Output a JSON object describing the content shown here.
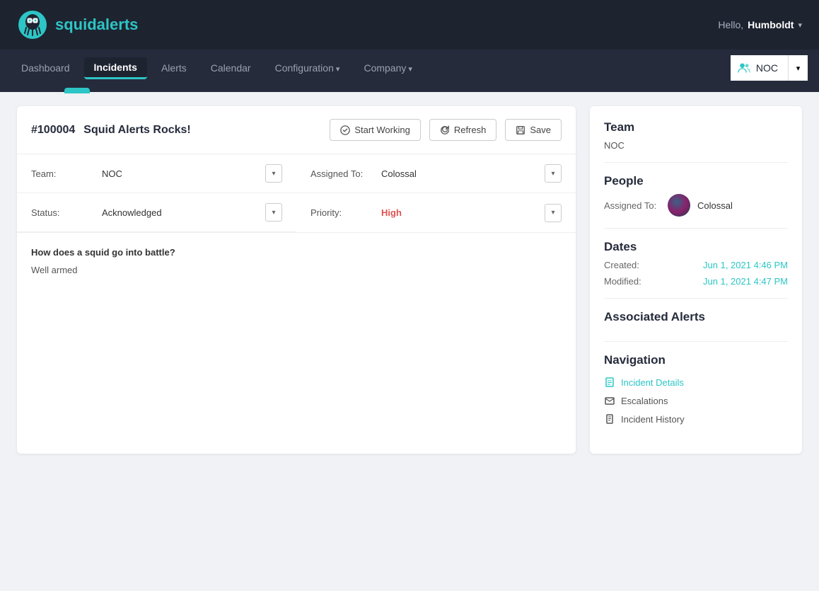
{
  "app": {
    "name_prefix": "squid",
    "name_suffix": "alerts"
  },
  "user": {
    "greeting": "Hello,",
    "username": "Humboldt"
  },
  "nav": {
    "items": [
      {
        "label": "Dashboard",
        "active": false,
        "has_arrow": false
      },
      {
        "label": "Incidents",
        "active": true,
        "has_arrow": false
      },
      {
        "label": "Alerts",
        "active": false,
        "has_arrow": false
      },
      {
        "label": "Calendar",
        "active": false,
        "has_arrow": false
      },
      {
        "label": "Configuration",
        "active": false,
        "has_arrow": true
      },
      {
        "label": "Company",
        "active": false,
        "has_arrow": true
      }
    ],
    "noc_label": "NOC"
  },
  "incident": {
    "number": "#100004",
    "title": "Squid Alerts Rocks!",
    "btn_start": "Start Working",
    "btn_refresh": "Refresh",
    "btn_save": "Save",
    "team_label": "Team:",
    "team_value": "NOC",
    "assigned_label": "Assigned To:",
    "assigned_value": "Colossal",
    "status_label": "Status:",
    "status_value": "Acknowledged",
    "priority_label": "Priority:",
    "priority_value": "High",
    "notes_question": "How does a squid go into battle?",
    "notes_answer": "Well armed"
  },
  "sidebar": {
    "team_title": "Team",
    "team_value": "NOC",
    "people_title": "People",
    "assigned_label": "Assigned To:",
    "assigned_name": "Colossal",
    "dates_title": "Dates",
    "created_label": "Created:",
    "created_value": "Jun 1, 2021 4:46 PM",
    "modified_label": "Modified:",
    "modified_value": "Jun 1, 2021 4:47 PM",
    "alerts_title": "Associated Alerts",
    "nav_title": "Navigation",
    "nav_items": [
      {
        "label": "Incident Details",
        "active": true,
        "icon": "document"
      },
      {
        "label": "Escalations",
        "active": false,
        "icon": "envelope"
      },
      {
        "label": "Incident History",
        "active": false,
        "icon": "clipboard"
      }
    ]
  }
}
